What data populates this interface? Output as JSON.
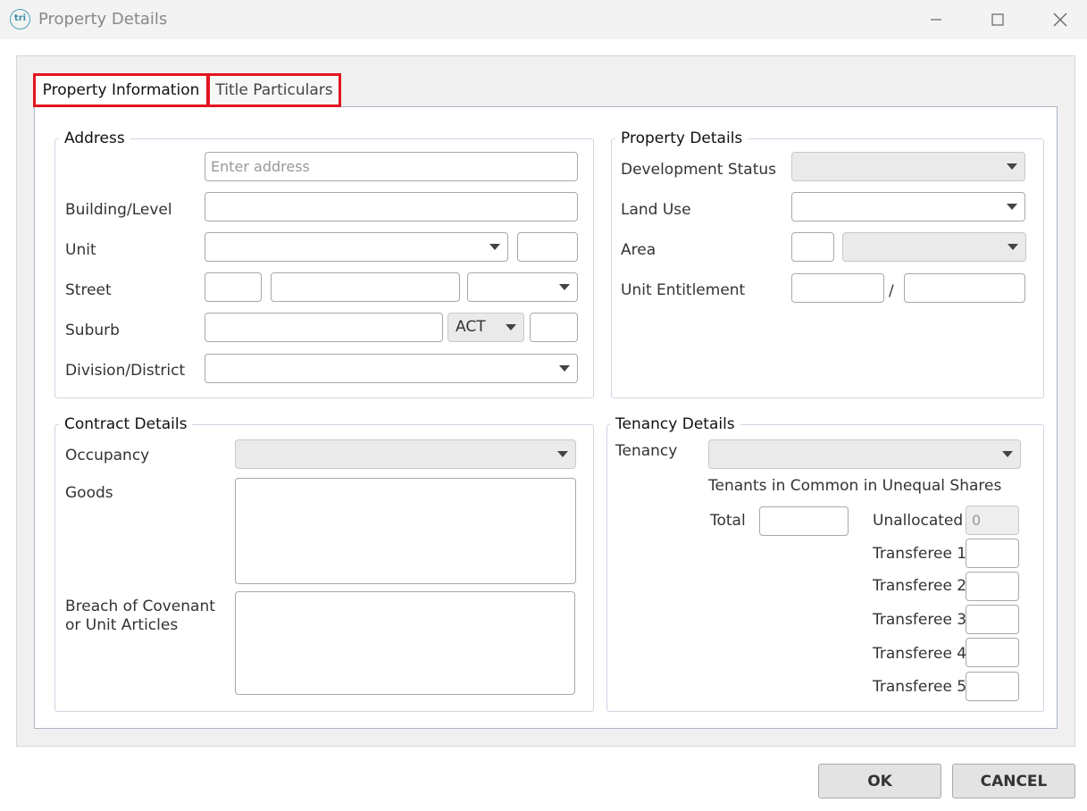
{
  "window": {
    "title": "Property Details",
    "icon": "tri"
  },
  "tabs": [
    {
      "label": "Property Information"
    },
    {
      "label": "Title Particulars"
    }
  ],
  "address": {
    "title": "Address",
    "search_placeholder": "Enter address",
    "building_level_label": "Building/Level",
    "unit_label": "Unit",
    "street_label": "Street",
    "suburb_label": "Suburb",
    "state_value": "ACT",
    "division_label": "Division/District"
  },
  "property_details": {
    "title": "Property Details",
    "development_status_label": "Development Status",
    "land_use_label": "Land Use",
    "area_label": "Area",
    "unit_entitlement_label": "Unit Entitlement",
    "separator": "/"
  },
  "contract_details": {
    "title": "Contract Details",
    "occupancy_label": "Occupancy",
    "goods_label": "Goods",
    "breach_label_line1": "Breach of Covenant",
    "breach_label_line2": "or Unit Articles"
  },
  "tenancy_details": {
    "title": "Tenancy Details",
    "tenancy_label": "Tenancy",
    "tenants_in_common": "Tenants in Common in Unequal Shares",
    "total_label": "Total",
    "unallocated_label": "Unallocated",
    "unallocated_value": "0",
    "transferees": [
      "Transferee 1",
      "Transferee 2",
      "Transferee 3",
      "Transferee 4",
      "Transferee 5"
    ]
  },
  "buttons": {
    "ok": "OK",
    "cancel": "CANCEL"
  }
}
